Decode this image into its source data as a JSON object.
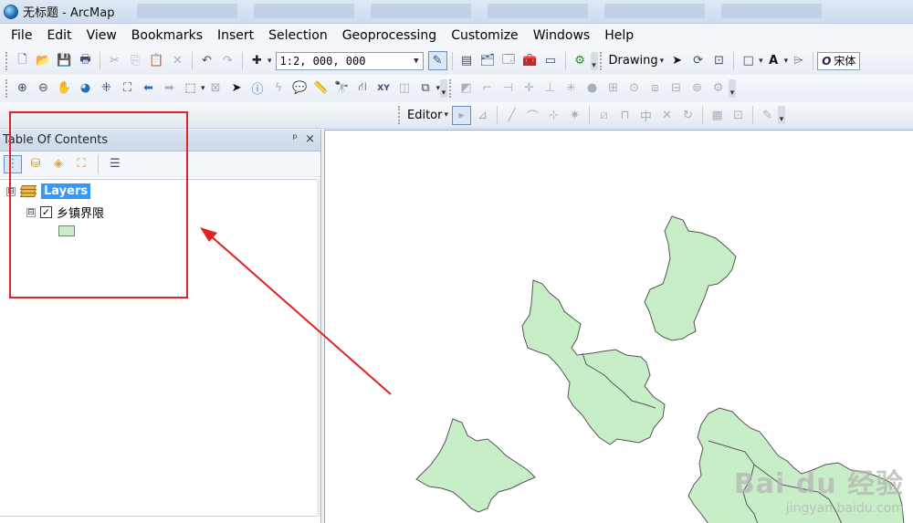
{
  "window": {
    "title": "无标题 - ArcMap"
  },
  "menu": [
    "File",
    "Edit",
    "View",
    "Bookmarks",
    "Insert",
    "Selection",
    "Geoprocessing",
    "Customize",
    "Windows",
    "Help"
  ],
  "toolbar": {
    "scale_value": "1:2, 000, 000",
    "drawing_label": "Drawing",
    "font_name": "宋体",
    "editor_label": "Editor"
  },
  "toc": {
    "title": "Table Of Contents",
    "pin_glyph": "ᵖ",
    "close_glyph": "×",
    "root_label": "Layers",
    "root_expander": "⊟",
    "layer_label": "乡镇界限",
    "layer_checked": "✓",
    "layer_expander": "⊟",
    "symbol_color": "#c8eec8"
  },
  "map": {
    "polygon_fill": "#c8eec8",
    "polygon_stroke": "#555555"
  },
  "annotation": {
    "highlight_color": "#e02424"
  },
  "watermark": {
    "logo": "Bai du 经验",
    "sub": "jingyan.baidu.com"
  }
}
